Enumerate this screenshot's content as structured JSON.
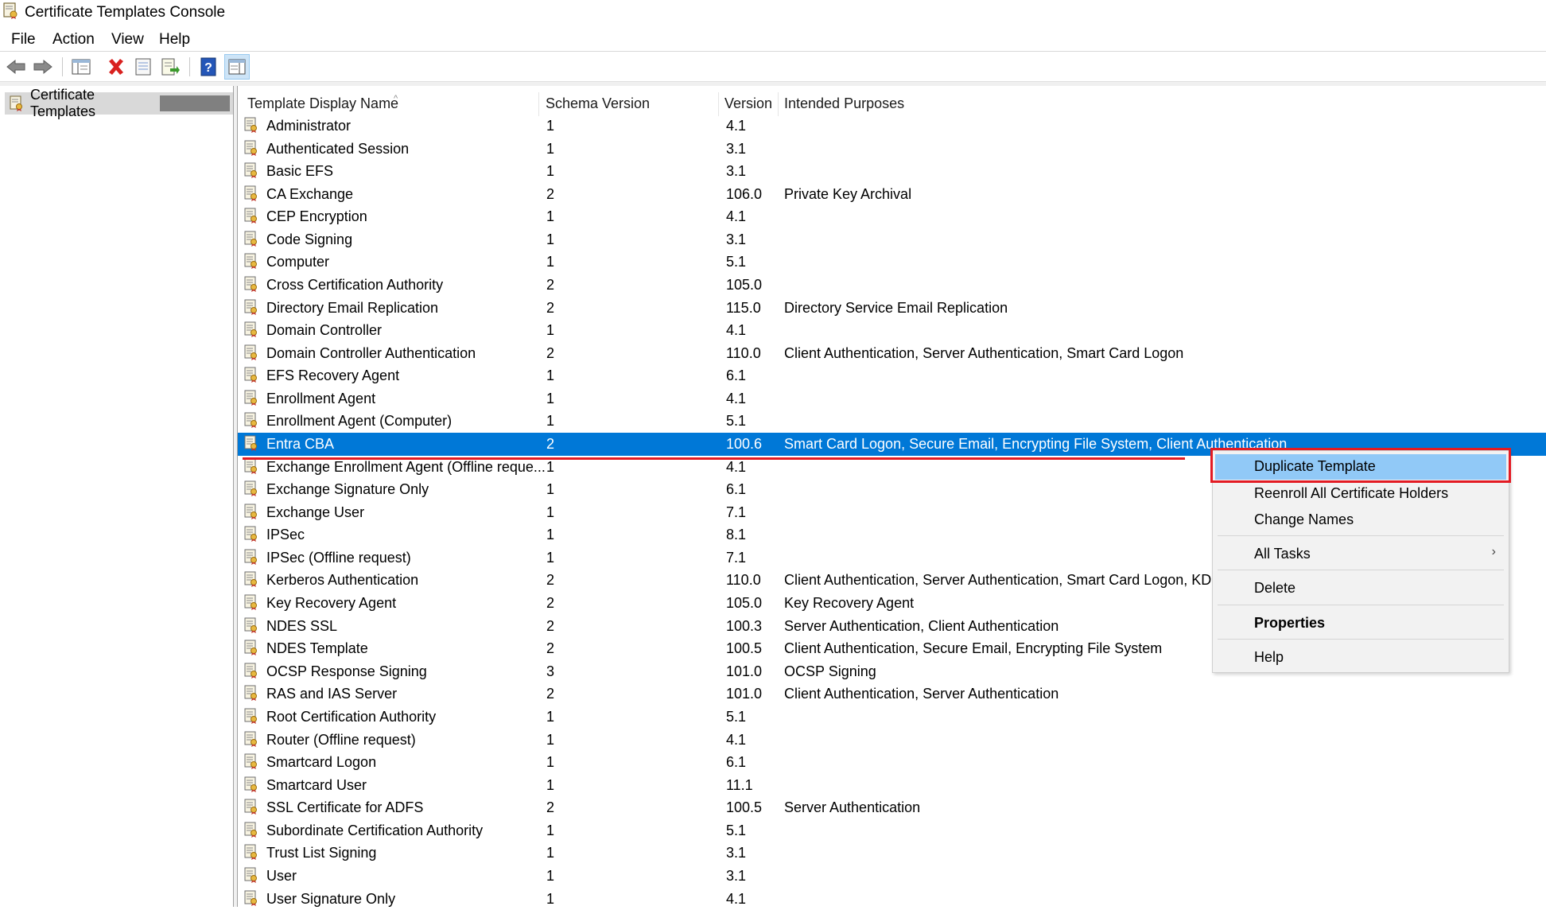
{
  "window": {
    "title": "Certificate Templates Console"
  },
  "menubar": {
    "items": [
      "File",
      "Action",
      "View",
      "Help"
    ]
  },
  "toolbar": {
    "icons": [
      "back-arrow-icon",
      "forward-arrow-icon",
      "show-hide-console-tree-icon",
      "delete-icon",
      "properties-icon",
      "export-list-icon",
      "help-icon",
      "action-pane-icon"
    ]
  },
  "tree": {
    "root_label": "Certificate Templates"
  },
  "columns": [
    "Template Display Name",
    "Schema Version",
    "Version",
    "Intended Purposes"
  ],
  "templates": [
    {
      "name": "Administrator",
      "schema": "1",
      "version": "4.1",
      "purposes": ""
    },
    {
      "name": "Authenticated Session",
      "schema": "1",
      "version": "3.1",
      "purposes": ""
    },
    {
      "name": "Basic EFS",
      "schema": "1",
      "version": "3.1",
      "purposes": ""
    },
    {
      "name": "CA Exchange",
      "schema": "2",
      "version": "106.0",
      "purposes": "Private Key Archival"
    },
    {
      "name": "CEP Encryption",
      "schema": "1",
      "version": "4.1",
      "purposes": ""
    },
    {
      "name": "Code Signing",
      "schema": "1",
      "version": "3.1",
      "purposes": ""
    },
    {
      "name": "Computer",
      "schema": "1",
      "version": "5.1",
      "purposes": ""
    },
    {
      "name": "Cross Certification Authority",
      "schema": "2",
      "version": "105.0",
      "purposes": ""
    },
    {
      "name": "Directory Email Replication",
      "schema": "2",
      "version": "115.0",
      "purposes": "Directory Service Email Replication"
    },
    {
      "name": "Domain Controller",
      "schema": "1",
      "version": "4.1",
      "purposes": ""
    },
    {
      "name": "Domain Controller Authentication",
      "schema": "2",
      "version": "110.0",
      "purposes": "Client Authentication, Server Authentication, Smart Card Logon"
    },
    {
      "name": "EFS Recovery Agent",
      "schema": "1",
      "version": "6.1",
      "purposes": ""
    },
    {
      "name": "Enrollment Agent",
      "schema": "1",
      "version": "4.1",
      "purposes": ""
    },
    {
      "name": "Enrollment Agent (Computer)",
      "schema": "1",
      "version": "5.1",
      "purposes": ""
    },
    {
      "name": "Entra CBA",
      "schema": "2",
      "version": "100.6",
      "purposes": "Smart Card Logon, Secure Email, Encrypting File System, Client Authentication",
      "selected": true
    },
    {
      "name": "Exchange Enrollment Agent (Offline reque...",
      "schema": "1",
      "version": "4.1",
      "purposes": ""
    },
    {
      "name": "Exchange Signature Only",
      "schema": "1",
      "version": "6.1",
      "purposes": ""
    },
    {
      "name": "Exchange User",
      "schema": "1",
      "version": "7.1",
      "purposes": ""
    },
    {
      "name": "IPSec",
      "schema": "1",
      "version": "8.1",
      "purposes": ""
    },
    {
      "name": "IPSec (Offline request)",
      "schema": "1",
      "version": "7.1",
      "purposes": ""
    },
    {
      "name": "Kerberos Authentication",
      "schema": "2",
      "version": "110.0",
      "purposes": "Client Authentication, Server Authentication, Smart Card Logon, KDC Authentication"
    },
    {
      "name": "Key Recovery Agent",
      "schema": "2",
      "version": "105.0",
      "purposes": "Key Recovery Agent"
    },
    {
      "name": "NDES SSL",
      "schema": "2",
      "version": "100.3",
      "purposes": "Server Authentication, Client Authentication"
    },
    {
      "name": "NDES Template",
      "schema": "2",
      "version": "100.5",
      "purposes": "Client Authentication, Secure Email, Encrypting File System"
    },
    {
      "name": "OCSP Response Signing",
      "schema": "3",
      "version": "101.0",
      "purposes": "OCSP Signing"
    },
    {
      "name": "RAS and IAS Server",
      "schema": "2",
      "version": "101.0",
      "purposes": "Client Authentication, Server Authentication"
    },
    {
      "name": "Root Certification Authority",
      "schema": "1",
      "version": "5.1",
      "purposes": ""
    },
    {
      "name": "Router (Offline request)",
      "schema": "1",
      "version": "4.1",
      "purposes": ""
    },
    {
      "name": "Smartcard Logon",
      "schema": "1",
      "version": "6.1",
      "purposes": ""
    },
    {
      "name": "Smartcard User",
      "schema": "1",
      "version": "11.1",
      "purposes": ""
    },
    {
      "name": "SSL Certificate for ADFS",
      "schema": "2",
      "version": "100.5",
      "purposes": "Server Authentication"
    },
    {
      "name": "Subordinate Certification Authority",
      "schema": "1",
      "version": "5.1",
      "purposes": ""
    },
    {
      "name": "Trust List Signing",
      "schema": "1",
      "version": "3.1",
      "purposes": ""
    },
    {
      "name": "User",
      "schema": "1",
      "version": "3.1",
      "purposes": ""
    },
    {
      "name": "User Signature Only",
      "schema": "1",
      "version": "4.1",
      "purposes": ""
    }
  ],
  "context_menu": {
    "items": [
      "Duplicate Template",
      "Reenroll All Certificate Holders",
      "Change Names",
      "All Tasks",
      "Delete",
      "Properties",
      "Help"
    ]
  },
  "colors": {
    "selection": "#0078d7",
    "highlight_box": "#e31b23",
    "menu_hover": "#91c9f7"
  }
}
